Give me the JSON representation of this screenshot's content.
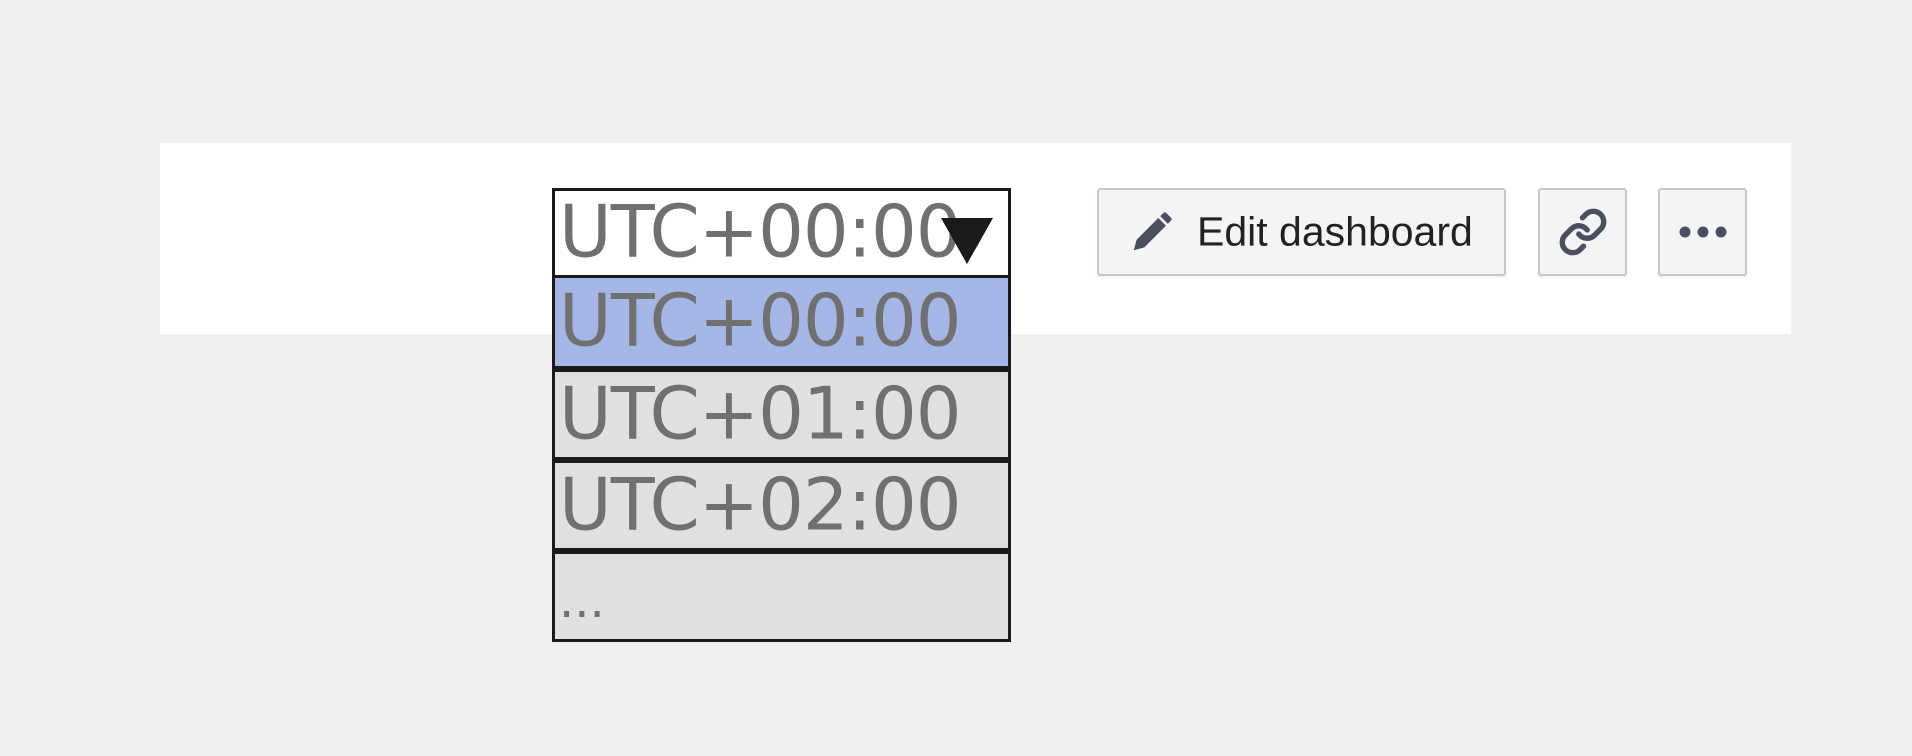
{
  "timezone": {
    "selected_value": "UTC+00:00",
    "options": [
      {
        "label": "UTC+00:00",
        "selected": true
      },
      {
        "label": "UTC+01:00",
        "selected": false
      },
      {
        "label": "UTC+02:00",
        "selected": false
      },
      {
        "label": "...",
        "selected": false
      }
    ]
  },
  "actions": {
    "edit_label": "Edit dashboard",
    "edit_icon": "pencil-icon",
    "link_icon": "link-icon",
    "more_icon": "more-horizontal-icon"
  },
  "colors": {
    "background": "#f0f0f0",
    "toolbar": "#ffffff",
    "option_selected": "#a4b6e5",
    "option_default": "#e0e0e0",
    "text_gray": "#707070",
    "icon": "#4a5060"
  }
}
